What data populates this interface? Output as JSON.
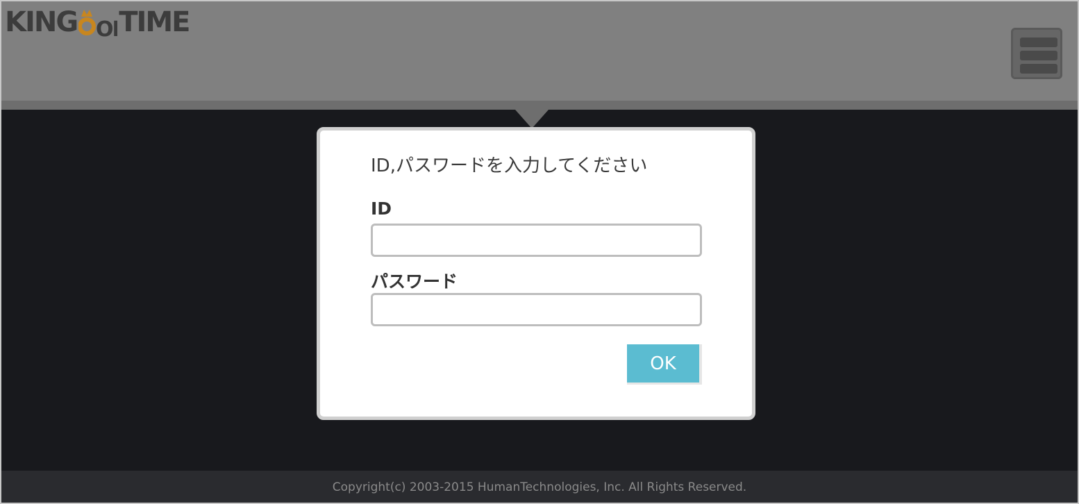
{
  "header": {
    "logo": {
      "part1": "KING",
      "part2": "OF",
      "part3": "TIME"
    },
    "menu_icon": "hamburger-menu-icon"
  },
  "dialog": {
    "prompt": "ID,パスワードを入力してください",
    "id_label": "ID",
    "id_value": "",
    "password_label": "パスワード",
    "password_value": "",
    "ok_label": "OK"
  },
  "footer": {
    "copyright": "Copyright(c) 2003-2015 HumanTechnologies, Inc. All Rights Reserved."
  },
  "colors": {
    "header_bg": "#808080",
    "body_bg": "#18191d",
    "ok_button": "#5bbcd1",
    "footer_bg": "#2a2b2f"
  }
}
